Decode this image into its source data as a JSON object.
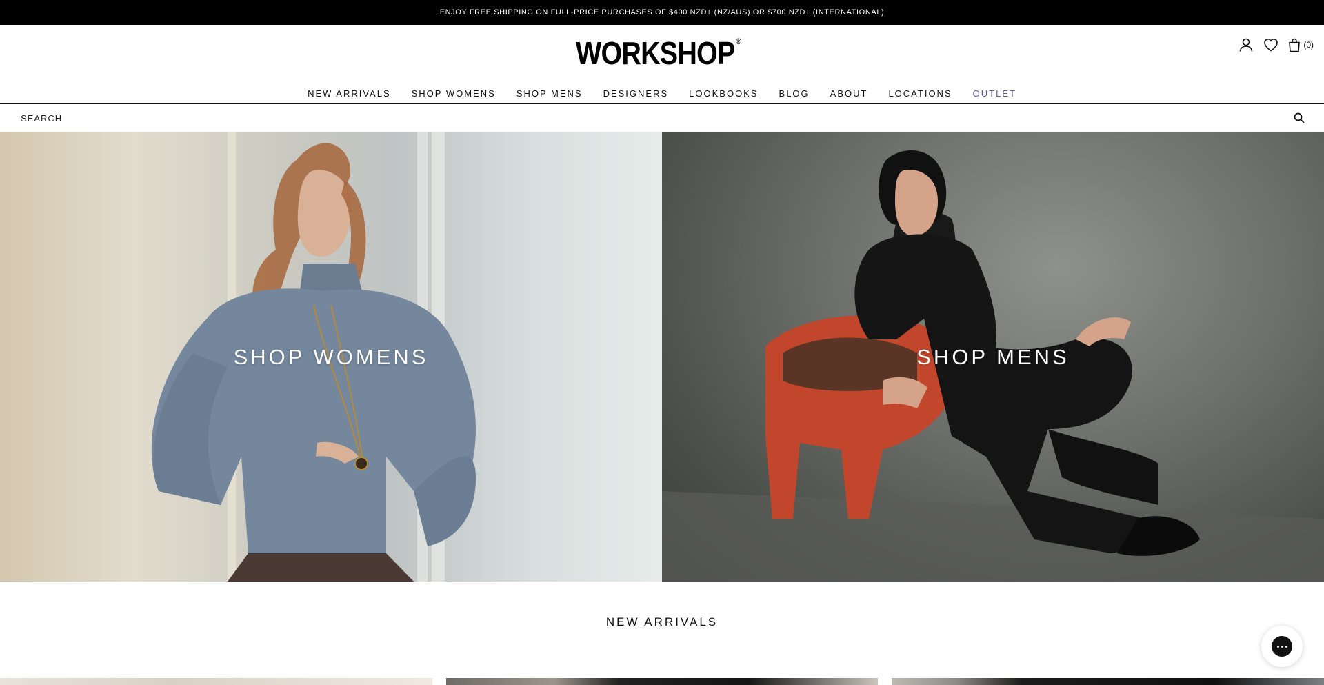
{
  "announcement": {
    "text": "ENJOY FREE SHIPPING ON FULL-PRICE PURCHASES OF $400 NZD+ (NZ/AUS) OR $700 NZD+ (INTERNATIONAL)"
  },
  "header": {
    "logo_text": "WORKSHOP",
    "logo_mark": "®",
    "icons": [
      "account-icon",
      "wishlist-heart-icon",
      "cart-bag-icon"
    ],
    "cart_count": "(0)"
  },
  "nav": {
    "items": [
      {
        "label": "NEW ARRIVALS"
      },
      {
        "label": "SHOP WOMENS"
      },
      {
        "label": "SHOP MENS"
      },
      {
        "label": "DESIGNERS"
      },
      {
        "label": "LOOKBOOKS"
      },
      {
        "label": "BLOG"
      },
      {
        "label": "ABOUT"
      },
      {
        "label": "LOCATIONS"
      },
      {
        "label": "OUTLET"
      }
    ],
    "outlet_color": "#5a5ea6"
  },
  "search": {
    "placeholder": "SEARCH",
    "icon": "search-icon"
  },
  "hero": {
    "left_label": "SHOP WOMENS",
    "right_label": "SHOP MENS"
  },
  "new_arrivals": {
    "title": "NEW ARRIVALS"
  },
  "chat": {
    "icon": "chat-bubble-icon"
  },
  "colors": {
    "accent": "#5a5ea6",
    "announcement_bg": "#000000"
  }
}
